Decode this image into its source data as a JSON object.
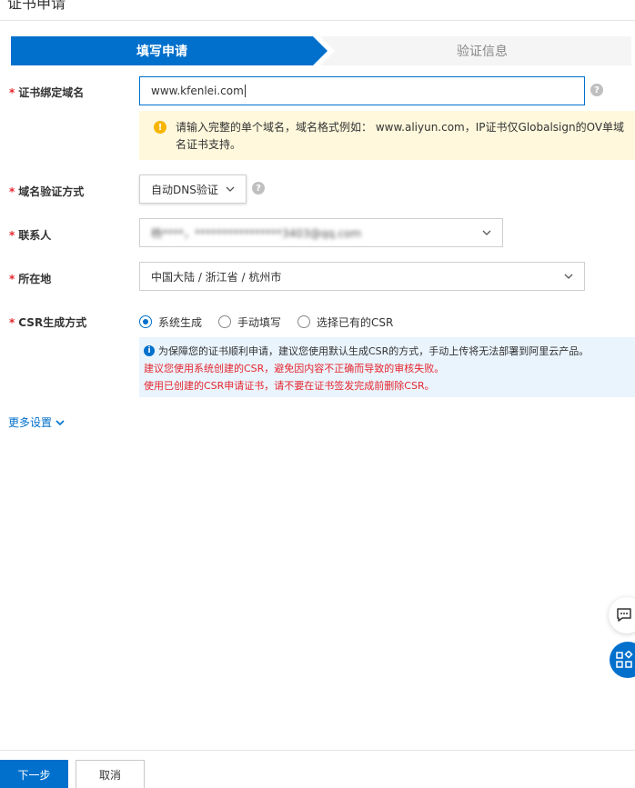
{
  "page": {
    "title": "证书申请"
  },
  "steps": [
    {
      "label": "填写申请",
      "active": true
    },
    {
      "label": "验证信息",
      "active": false
    }
  ],
  "form": {
    "domain": {
      "label": "证书绑定域名",
      "value": "www.kfenlei.com",
      "hint": "请输入完整的单个域名，域名格式例如： www.aliyun.com，IP证书仅Globalsign的OV单域名证书支持。"
    },
    "verify_method": {
      "label": "域名验证方式",
      "value": "自动DNS验证"
    },
    "contact": {
      "label": "联系人",
      "value": "杨****，****************3403@qq.com"
    },
    "location": {
      "label": "所在地",
      "value": "中国大陆 / 浙江省 / 杭州市"
    },
    "csr": {
      "label": "CSR生成方式",
      "options": [
        {
          "label": "系统生成",
          "checked": true
        },
        {
          "label": "手动填写",
          "checked": false
        },
        {
          "label": "选择已有的CSR",
          "checked": false
        }
      ],
      "info_line1": "为保障您的证书顺利申请，建议您使用默认生成CSR的方式，手动上传将无法部署到阿里云产品。",
      "info_line2": "建议您使用系统创建的CSR，避免因内容不正确而导致的审核失败。",
      "info_line3": "使用已创建的CSR申请证书，请不要在证书签发完成前删除CSR。"
    },
    "required_mark": "*"
  },
  "more_settings": "更多设置",
  "footer": {
    "next_label": "下一步",
    "cancel_label": "取消"
  },
  "icons": {
    "help": "question-mark-icon",
    "warning": "warning-icon",
    "info": "info-icon",
    "chat": "chat-icon",
    "apps": "apps-icon"
  },
  "colors": {
    "primary": "#0070cc",
    "danger": "#e5262e",
    "warning_bg": "#fff8dc",
    "info_bg": "#eaf4fd"
  }
}
